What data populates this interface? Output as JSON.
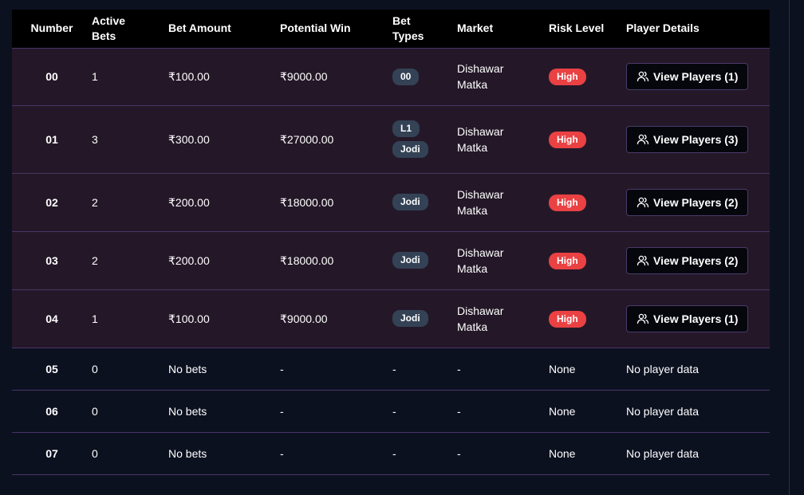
{
  "headers": {
    "number": "Number",
    "active_bets_1": "Active",
    "active_bets_2": "Bets",
    "bet_amount": "Bet Amount",
    "potential_win": "Potential Win",
    "bet_types_1": "Bet",
    "bet_types_2": "Types",
    "market": "Market",
    "risk_level": "Risk Level",
    "player_details": "Player Details"
  },
  "rows": [
    {
      "number": "00",
      "active": "1",
      "amount": "₹100.00",
      "win": "₹9000.00",
      "types": [
        "00"
      ],
      "market_1": "Dishawar",
      "market_2": "Matka",
      "risk": "High",
      "button": "View Players (1)"
    },
    {
      "number": "01",
      "active": "3",
      "amount": "₹300.00",
      "win": "₹27000.00",
      "types": [
        "L1",
        "Jodi"
      ],
      "market_1": "Dishawar",
      "market_2": "Matka",
      "risk": "High",
      "button": "View Players (3)"
    },
    {
      "number": "02",
      "active": "2",
      "amount": "₹200.00",
      "win": "₹18000.00",
      "types": [
        "Jodi"
      ],
      "market_1": "Dishawar",
      "market_2": "Matka",
      "risk": "High",
      "button": "View Players (2)"
    },
    {
      "number": "03",
      "active": "2",
      "amount": "₹200.00",
      "win": "₹18000.00",
      "types": [
        "Jodi"
      ],
      "market_1": "Dishawar",
      "market_2": "Matka",
      "risk": "High",
      "button": "View Players (2)"
    },
    {
      "number": "04",
      "active": "1",
      "amount": "₹100.00",
      "win": "₹9000.00",
      "types": [
        "Jodi"
      ],
      "market_1": "Dishawar",
      "market_2": "Matka",
      "risk": "High",
      "button": "View Players (1)"
    }
  ],
  "empty_rows": [
    {
      "number": "05",
      "active": "0",
      "amount": "No bets",
      "win": "-",
      "types": "-",
      "market": "-",
      "risk": "None",
      "details": "No player data"
    },
    {
      "number": "06",
      "active": "0",
      "amount": "No bets",
      "win": "-",
      "types": "-",
      "market": "-",
      "risk": "None",
      "details": "No player data"
    },
    {
      "number": "07",
      "active": "0",
      "amount": "No bets",
      "win": "-",
      "types": "-",
      "market": "-",
      "risk": "None",
      "details": "No player data"
    }
  ],
  "icons": {
    "player_button": "users-icon"
  },
  "colors": {
    "risk_high": "#ea4143",
    "pill": "#344256",
    "row_active": "#241828",
    "divider": "#4a3366"
  }
}
